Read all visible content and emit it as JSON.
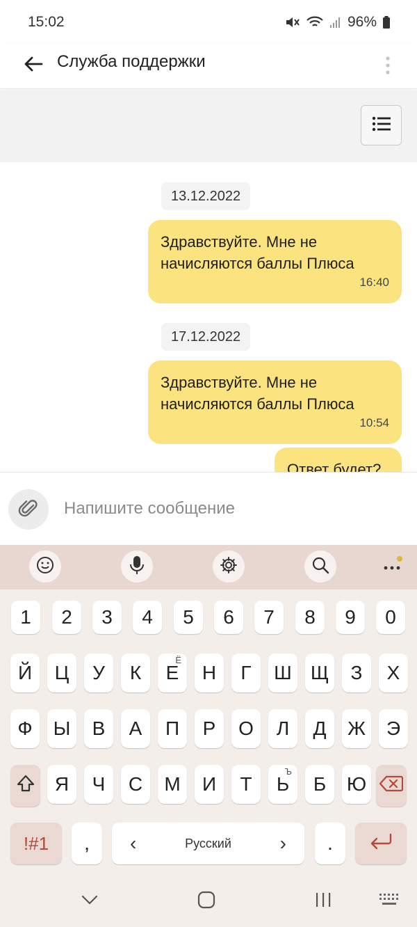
{
  "status": {
    "time": "15:02",
    "battery": "96%",
    "icons": [
      "mute-icon",
      "wifi-icon",
      "signal-icon",
      "battery-icon"
    ]
  },
  "header": {
    "title": "Служба поддержки",
    "icons": [
      "back-arrow-icon",
      "more-vertical-icon"
    ]
  },
  "toolbar": {
    "icons": [
      "list-icon"
    ]
  },
  "chat": {
    "groups": [
      {
        "date": "13.12.2022",
        "messages": [
          {
            "text": "Здравствуйте. Мне не\nначисляются баллы Плюса",
            "time": "16:40"
          }
        ]
      },
      {
        "date": "17.12.2022",
        "messages": [
          {
            "text": "Здравствуйте. Мне не\nначисляются баллы Плюса",
            "time": "10:54"
          },
          {
            "text": "Ответ будет?",
            "time": ""
          }
        ]
      }
    ]
  },
  "composer": {
    "placeholder": "Напишите сообщение",
    "icons": [
      "paperclip-icon"
    ]
  },
  "keyboard": {
    "toolbar_icons": [
      "emoji-icon",
      "microphone-icon",
      "settings-icon",
      "search-icon",
      "more-horizontal-icon"
    ],
    "rows": [
      [
        "1",
        "2",
        "3",
        "4",
        "5",
        "6",
        "7",
        "8",
        "9",
        "0"
      ],
      [
        "Й",
        "Ц",
        "У",
        "К",
        "Е",
        "Н",
        "Г",
        "Ш",
        "Щ",
        "З",
        "Х"
      ],
      [
        "Ф",
        "Ы",
        "В",
        "А",
        "П",
        "Р",
        "О",
        "Л",
        "Д",
        "Ж",
        "Э"
      ],
      [
        "Я",
        "Ч",
        "С",
        "М",
        "И",
        "Т",
        "Ь",
        "Б",
        "Ю"
      ]
    ],
    "hints": {
      "e": "Ё",
      "soft": "Ъ"
    },
    "symbols_key": "!#1",
    "comma_key": ",",
    "space_label": "Русский",
    "space_left": "‹",
    "space_right": "›",
    "period_key": ".",
    "accent_color": "#b3493a"
  },
  "navbar": {
    "icons": [
      "nav-back-icon",
      "home-icon",
      "recents-icon",
      "keyboard-switch-icon"
    ]
  }
}
